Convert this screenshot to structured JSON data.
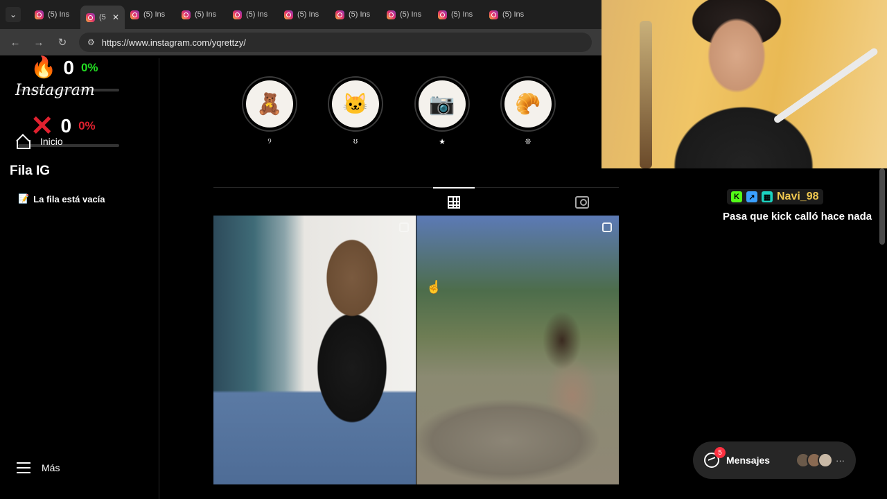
{
  "browser": {
    "tab_label": "(5) Ins",
    "active_tab_label": "(5",
    "tab_count": 11,
    "url": "https://www.instagram.com/yqrettzy/"
  },
  "overlay": {
    "hits": {
      "icon": "fire-icon",
      "count": "0",
      "percent": "0%",
      "color": "#22dd22"
    },
    "misses": {
      "icon": "x-icon",
      "count": "0",
      "percent": "0%",
      "color": "#e0212f"
    }
  },
  "sidebar": {
    "logo": "Instagram",
    "home_label": "Inicio",
    "queue_title": "Fila IG",
    "queue_empty": "La fila está vacía",
    "more_label": "Más"
  },
  "highlights": [
    {
      "label": "୨",
      "emoji": "🧸"
    },
    {
      "label": "ʊ",
      "emoji": "🐱"
    },
    {
      "label": "★",
      "emoji": "📷"
    },
    {
      "label": "❊",
      "emoji": "🥐"
    }
  ],
  "chat": {
    "username": "Navi_98",
    "message": "Pasa que kick calló hace nada"
  },
  "messages": {
    "label": "Mensajes",
    "badge": "5",
    "more": "···"
  }
}
